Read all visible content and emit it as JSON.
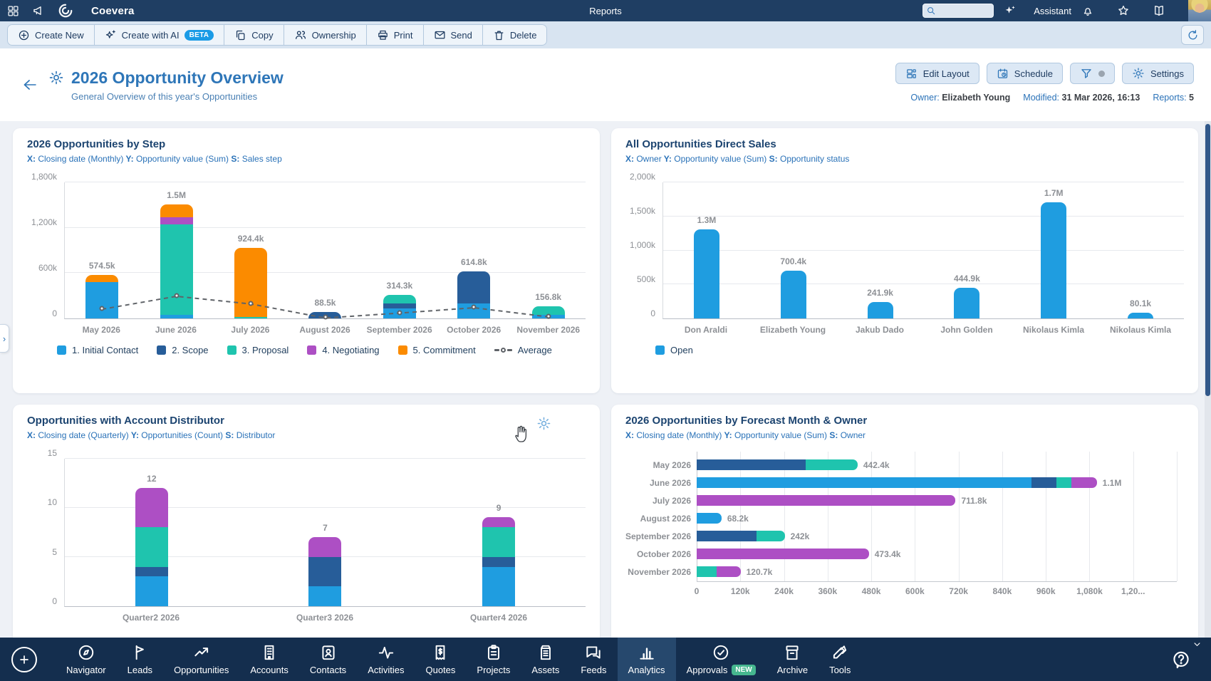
{
  "topbar": {
    "brand": "Coevera",
    "page": "Reports",
    "assistant": "Assistant",
    "search_placeholder": "",
    "left_icons": [
      "app-grid-icon",
      "megaphone-icon"
    ],
    "right_icons": [
      "bell-icon",
      "star-icon",
      "book-icon"
    ]
  },
  "toolbar": {
    "buttons": [
      {
        "label": "Create New",
        "icon": "plus-circle"
      },
      {
        "label": "Create with AI",
        "icon": "ai-sparkles",
        "badge": "BETA"
      },
      {
        "label": "Copy",
        "icon": "copy"
      },
      {
        "label": "Ownership",
        "icon": "people"
      },
      {
        "label": "Print",
        "icon": "printer"
      },
      {
        "label": "Send",
        "icon": "send"
      },
      {
        "label": "Delete",
        "icon": "trash"
      }
    ]
  },
  "header": {
    "title": "2026 Opportunity Overview",
    "subtitle": "General Overview of this year's Opportunities",
    "actions": [
      {
        "label": "Edit Layout",
        "icon": "layout"
      },
      {
        "label": "Schedule",
        "icon": "calendar-clock"
      },
      {
        "label": "",
        "icon": "filter",
        "dot": true
      },
      {
        "label": "Settings",
        "icon": "gear"
      }
    ],
    "meta": {
      "owner_label": "Owner:",
      "owner": "Elizabeth Young",
      "modified_label": "Modified:",
      "modified": "31 Mar 2026, 16:13",
      "reports_label": "Reports:",
      "reports": "5"
    }
  },
  "colors": {
    "lightblue": "#1f9de0",
    "darkblue": "#275d99",
    "teal": "#1fc4ae",
    "purple": "#ad4fc4",
    "orange": "#fb8b00",
    "average": "#5f6368"
  },
  "chart_data": [
    {
      "type": "bar",
      "stacked": true,
      "orientation": "vertical",
      "title": "2026 Opportunities by Step",
      "subtitle_parts": [
        [
          "X:",
          "Closing date (Monthly)"
        ],
        [
          "Y:",
          "Opportunity value (Sum)"
        ],
        [
          "S:",
          "Sales step"
        ]
      ],
      "categories": [
        "May 2026",
        "June 2026",
        "July 2026",
        "August 2026",
        "September 2026",
        "October 2026",
        "November 2026"
      ],
      "unit": "thousands",
      "series": [
        {
          "name": "1. Initial Contact",
          "color": "#1f9de0",
          "values": [
            480,
            50,
            0,
            0,
            130,
            200,
            45
          ]
        },
        {
          "name": "2. Scope",
          "color": "#275d99",
          "values": [
            0,
            0,
            0,
            88.5,
            70,
            414.8,
            0
          ]
        },
        {
          "name": "3. Proposal",
          "color": "#1fc4ae",
          "values": [
            0,
            1185,
            20,
            0,
            114.3,
            0,
            111.8
          ]
        },
        {
          "name": "4. Negotiating",
          "color": "#ad4fc4",
          "values": [
            0,
            95,
            0,
            0,
            0,
            0,
            0
          ]
        },
        {
          "name": "5. Commitment",
          "color": "#fb8b00",
          "values": [
            94.5,
            170,
            904.4,
            0,
            0,
            0,
            0
          ]
        }
      ],
      "totals_labels": [
        "574.5k",
        "1.5M",
        "924.4k",
        "88.5k",
        "314.3k",
        "614.8k",
        "156.8k"
      ],
      "average": {
        "name": "Average",
        "values": [
          130,
          300,
          200,
          15,
          80,
          150,
          30
        ]
      },
      "ylim": [
        0,
        1800
      ],
      "yticks": [
        {
          "v": 1800,
          "label": "1,800k"
        },
        {
          "v": 1200,
          "label": "1,200k"
        },
        {
          "v": 600,
          "label": "600k"
        },
        {
          "v": 0,
          "label": "0"
        }
      ],
      "legend_position": "bottom",
      "grid": true
    },
    {
      "type": "bar",
      "stacked": false,
      "orientation": "vertical",
      "title": "All Opportunities Direct Sales",
      "subtitle_parts": [
        [
          "X:",
          "Owner"
        ],
        [
          "Y:",
          "Opportunity value (Sum)"
        ],
        [
          "S:",
          "Opportunity status"
        ]
      ],
      "categories": [
        "Don Araldi",
        "Elizabeth Young",
        "Jakub Dado",
        "John Golden",
        "Nikolaus Kimla",
        "Nikolaus Kimla"
      ],
      "unit": "thousands",
      "series": [
        {
          "name": "Open",
          "color": "#1f9de0",
          "values": [
            1300,
            700.4,
            241.9,
            444.9,
            1700,
            80.1
          ]
        }
      ],
      "totals_labels": [
        "1.3M",
        "700.4k",
        "241.9k",
        "444.9k",
        "1.7M",
        "80.1k"
      ],
      "ylim": [
        0,
        2000
      ],
      "yticks": [
        {
          "v": 2000,
          "label": "2,000k"
        },
        {
          "v": 1500,
          "label": "1,500k"
        },
        {
          "v": 1000,
          "label": "1,000k"
        },
        {
          "v": 500,
          "label": "500k"
        },
        {
          "v": 0,
          "label": "0"
        }
      ],
      "legend_position": "bottom",
      "grid": true
    },
    {
      "type": "bar",
      "stacked": true,
      "orientation": "vertical",
      "title": "Opportunities with Account Distributor",
      "subtitle_parts": [
        [
          "X:",
          "Closing date (Quarterly)"
        ],
        [
          "Y:",
          "Opportunities (Count)"
        ],
        [
          "S:",
          "Distributor"
        ]
      ],
      "categories": [
        "Quarter2 2026",
        "Quarter3 2026",
        "Quarter4 2026"
      ],
      "unit": "count",
      "series": [
        {
          "color": "#1f9de0",
          "values": [
            3,
            2,
            4
          ]
        },
        {
          "color": "#275d99",
          "values": [
            1,
            3,
            1
          ]
        },
        {
          "color": "#1fc4ae",
          "values": [
            4,
            0,
            3
          ]
        },
        {
          "color": "#ad4fc4",
          "values": [
            4,
            2,
            1
          ]
        }
      ],
      "totals_labels": [
        "12",
        "7",
        "9"
      ],
      "ylim": [
        0,
        15
      ],
      "yticks": [
        {
          "v": 15,
          "label": "15"
        },
        {
          "v": 10,
          "label": "10"
        },
        {
          "v": 5,
          "label": "5"
        },
        {
          "v": 0,
          "label": "0"
        }
      ],
      "grid": true
    },
    {
      "type": "bar",
      "stacked": true,
      "orientation": "horizontal",
      "title": "2026 Opportunities by Forecast Month & Owner",
      "subtitle_parts": [
        [
          "X:",
          "Closing date (Monthly)"
        ],
        [
          "Y:",
          "Opportunity value (Sum)"
        ],
        [
          "S:",
          "Owner"
        ]
      ],
      "categories": [
        "May 2026",
        "June 2026",
        "July 2026",
        "August 2026",
        "September 2026",
        "October 2026",
        "November 2026"
      ],
      "unit": "thousands",
      "series": [
        {
          "color": "#1f9de0",
          "values": [
            0,
            920,
            0,
            68.2,
            0,
            0,
            0
          ]
        },
        {
          "color": "#275d99",
          "values": [
            300,
            70,
            0,
            0,
            165,
            0,
            0
          ]
        },
        {
          "color": "#1fc4ae",
          "values": [
            142.4,
            40,
            0,
            0,
            77,
            0,
            55
          ]
        },
        {
          "color": "#ad4fc4",
          "values": [
            0,
            70,
            711.8,
            0,
            0,
            473.4,
            65.7
          ]
        }
      ],
      "totals_labels": [
        "442.4k",
        "1.1M",
        "711.8k",
        "68.2k",
        "242k",
        "473.4k",
        "120.7k"
      ],
      "xlim": [
        0,
        1320
      ],
      "xticks": [
        {
          "v": 0,
          "label": "0"
        },
        {
          "v": 120,
          "label": "120k"
        },
        {
          "v": 240,
          "label": "240k"
        },
        {
          "v": 360,
          "label": "360k"
        },
        {
          "v": 480,
          "label": "480k"
        },
        {
          "v": 600,
          "label": "600k"
        },
        {
          "v": 720,
          "label": "720k"
        },
        {
          "v": 840,
          "label": "840k"
        },
        {
          "v": 960,
          "label": "960k"
        },
        {
          "v": 1080,
          "label": "1,080k"
        },
        {
          "v": 1200,
          "label": "1,20..."
        }
      ],
      "grid": true
    }
  ],
  "bottom_nav": {
    "items": [
      {
        "label": "Navigator",
        "icon": "compass"
      },
      {
        "label": "Leads",
        "icon": "flag"
      },
      {
        "label": "Opportunities",
        "icon": "trending-up"
      },
      {
        "label": "Accounts",
        "icon": "building"
      },
      {
        "label": "Contacts",
        "icon": "contact-card"
      },
      {
        "label": "Activities",
        "icon": "activity-pulse"
      },
      {
        "label": "Quotes",
        "icon": "receipt-dollar"
      },
      {
        "label": "Projects",
        "icon": "clipboard"
      },
      {
        "label": "Assets",
        "icon": "asset-box"
      },
      {
        "label": "Feeds",
        "icon": "chat-bubbles"
      },
      {
        "label": "Analytics",
        "icon": "bar-chart",
        "active": true
      },
      {
        "label": "Approvals",
        "icon": "check-circle",
        "badge": "NEW"
      },
      {
        "label": "Archive",
        "icon": "archive-box"
      },
      {
        "label": "Tools",
        "icon": "tools-knife"
      }
    ]
  }
}
